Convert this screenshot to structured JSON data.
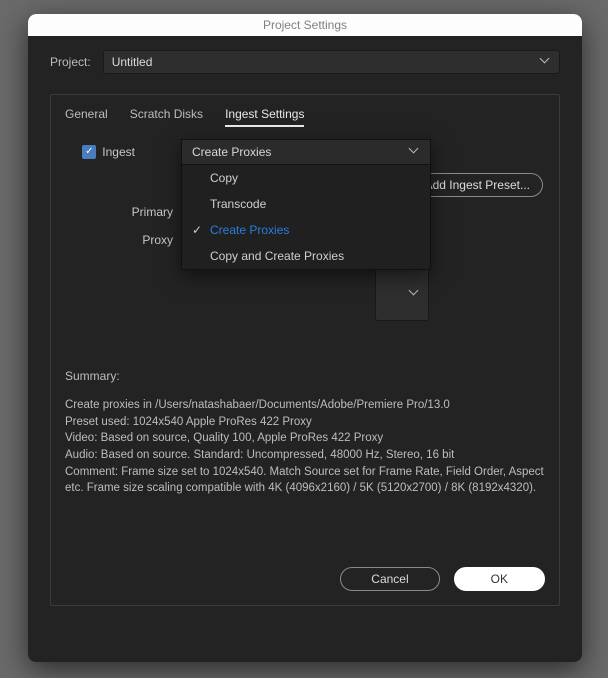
{
  "window": {
    "title": "Project Settings"
  },
  "project": {
    "label": "Project:",
    "name": "Untitled"
  },
  "tabs": {
    "general": "General",
    "scratch": "Scratch Disks",
    "ingest": "Ingest Settings"
  },
  "ingest": {
    "checkbox_label": "Ingest",
    "dropdown_selected": "Create Proxies",
    "options": {
      "copy": "Copy",
      "transcode": "Transcode",
      "create_proxies": "Create Proxies",
      "copy_and_create": "Copy and Create Proxies"
    },
    "primary_label": "Primary",
    "proxy_label": "Proxy",
    "add_preset_btn": "Add Ingest Preset..."
  },
  "summary": {
    "heading": "Summary:",
    "body": "Create proxies in /Users/natashabaer/Documents/Adobe/Premiere Pro/13.0\nPreset used: 1024x540 Apple ProRes 422 Proxy\nVideo: Based on source, Quality 100, Apple ProRes 422 Proxy\nAudio: Based on source. Standard: Uncompressed, 48000 Hz, Stereo, 16 bit\nComment: Frame size set to 1024x540. Match Source set for Frame Rate, Field Order, Aspect etc. Frame size scaling compatible with 4K (4096x2160) / 5K (5120x2700) / 8K (8192x4320)."
  },
  "buttons": {
    "cancel": "Cancel",
    "ok": "OK"
  }
}
